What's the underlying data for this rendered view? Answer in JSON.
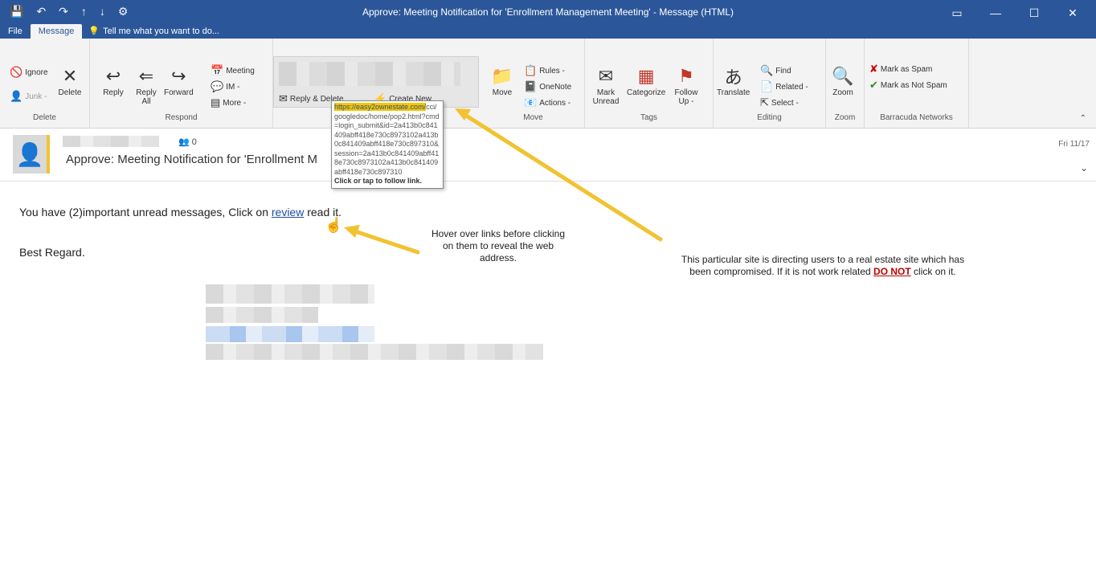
{
  "window": {
    "title": "Approve: Meeting Notification for 'Enrollment Management Meeting' - Message (HTML)",
    "controls": [
      "▭",
      "—",
      "☐",
      "✕"
    ]
  },
  "tabs": {
    "file": "File",
    "message": "Message",
    "tell_me": "Tell me what you want to do..."
  },
  "ribbon": {
    "delete_group": {
      "label": "Delete",
      "ignore": "Ignore",
      "junk": "Junk -",
      "delete": "Delete"
    },
    "respond_group": {
      "label": "Respond",
      "reply": "Reply",
      "reply_all": "Reply All",
      "forward": "Forward",
      "meeting": "Meeting",
      "im": "IM -",
      "more": "More -"
    },
    "quick_steps": {
      "reply_delete": "Reply & Delete",
      "create_new": "Create New"
    },
    "move_group": {
      "label": "Move",
      "move": "Move",
      "rules": "Rules -",
      "onenote": "OneNote",
      "actions": "Actions -"
    },
    "tags_group": {
      "label": "Tags",
      "mark_unread": "Mark Unread",
      "categorize": "Categorize",
      "follow_up": "Follow Up -"
    },
    "editing_group": {
      "label": "Editing",
      "translate": "Translate",
      "find": "Find",
      "related": "Related -",
      "select": "Select -"
    },
    "zoom_group": {
      "label": "Zoom",
      "zoom": "Zoom"
    },
    "barracuda_group": {
      "label": "Barracuda Networks",
      "spam": "Mark as Spam",
      "not_spam": "Mark as Not Spam"
    }
  },
  "message": {
    "people_count": "0",
    "subject": "Approve: Meeting Notification for 'Enrollment M",
    "date": "Fri 11/17",
    "line1_before": "You have (2)important unread messages, Click on ",
    "line1_link": "review",
    "line1_after": " read it.",
    "line2": "Best Regard."
  },
  "tooltip": {
    "url_highlight": "https://easy2ownestate.com/",
    "url_rest": "cci/googledoc/home/pop2.html?cmd=login_submit&id=2a413b0c841409abff418e730c8973102a413b0c841409abff418e730c897310&session=2a413b0c841409abff418e730c8973102a413b0c841409abff418e730c897310",
    "action": "Click or tap to follow link."
  },
  "annotations": {
    "hover": "Hover over links before clicking on them to reveal the web address.",
    "site_line1": "This particular site is directing users to a real estate site which has",
    "site_line2_before": "been compromised. If it is not work related ",
    "site_donot": "DO NOT",
    "site_line2_after": " click on it."
  },
  "colors": {
    "titlebar": "#2b579a",
    "ribbon": "#f3f3f3",
    "arrow": "#f1c232",
    "donot": "#c00000",
    "link": "#1f4e9c"
  }
}
